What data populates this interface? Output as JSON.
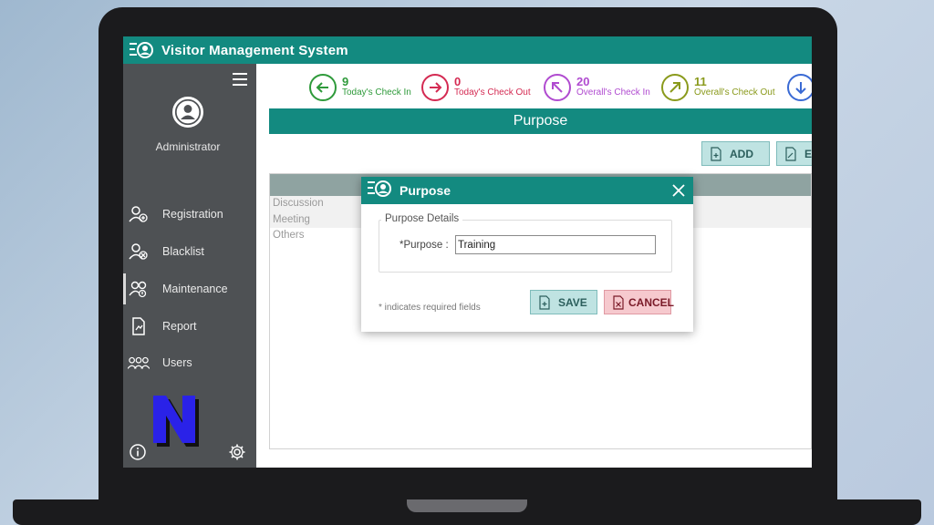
{
  "app": {
    "title": "Visitor Management System"
  },
  "sidebar": {
    "user_name": "Administrator",
    "items": [
      {
        "label": "Registration",
        "icon": "user-add-icon"
      },
      {
        "label": "Blacklist",
        "icon": "user-block-icon"
      },
      {
        "label": "Maintenance",
        "icon": "users-maintenance-icon",
        "active": true
      },
      {
        "label": "Report",
        "icon": "report-icon"
      },
      {
        "label": "Users",
        "icon": "users-icon"
      }
    ]
  },
  "stats": [
    {
      "value": "9",
      "label": "Today's Check In",
      "color": "#2e9a3a",
      "icon": "arrow-left-icon"
    },
    {
      "value": "0",
      "label": "Today's Check Out",
      "color": "#d42a52",
      "icon": "arrow-right-icon"
    },
    {
      "value": "20",
      "label": "Overall's Check In",
      "color": "#b04bd0",
      "icon": "arrow-up-left-icon"
    },
    {
      "value": "11",
      "label": "Overall's Check Out",
      "color": "#8a9a1c",
      "icon": "arrow-up-right-icon"
    }
  ],
  "main": {
    "header": "Purpose",
    "add_label": "ADD",
    "edit_label": "E",
    "list": [
      "Discussion",
      "Meeting",
      "Others"
    ]
  },
  "modal": {
    "title": "Purpose",
    "section_legend": "Purpose Details",
    "field_label": "*Purpose :",
    "field_value": "Training",
    "required_note": "* indicates required fields",
    "save_label": "SAVE",
    "cancel_label": "CANCEL"
  },
  "colors": {
    "teal": "#138a80",
    "sidebar": "#4e5154",
    "save_bg": "#bfe3e2",
    "cancel_bg": "#f6c9ce"
  }
}
